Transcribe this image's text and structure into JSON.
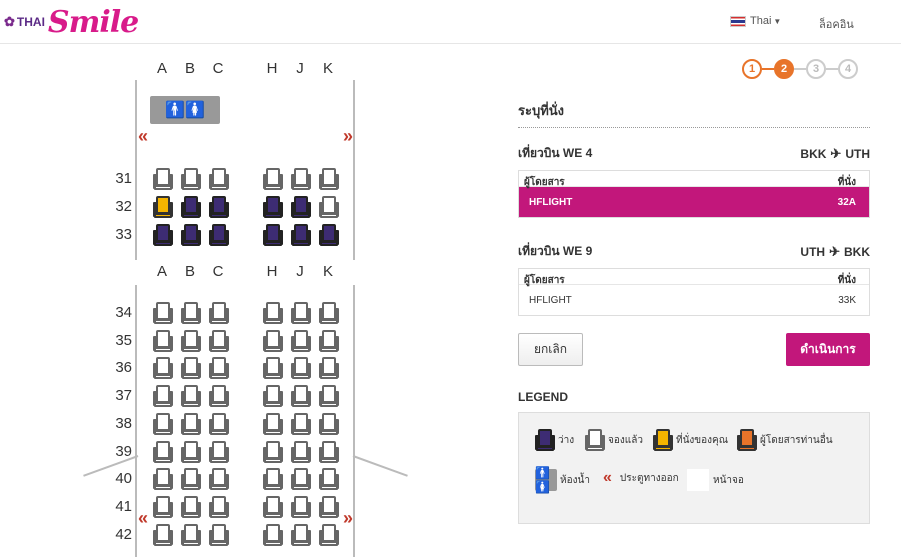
{
  "header": {
    "logo_thai": "THAI",
    "logo_smile": "Smile",
    "language": "Thai",
    "login": "ล็อคอิน"
  },
  "steps": [
    "1",
    "2",
    "3",
    "4"
  ],
  "seatmap": {
    "columns": [
      "A",
      "B",
      "C",
      "H",
      "J",
      "K"
    ],
    "rows_front": [
      {
        "num": "31",
        "seats": [
          "occupied",
          "occupied",
          "occupied",
          "occupied",
          "occupied",
          "occupied"
        ]
      },
      {
        "num": "32",
        "seats": [
          "yours",
          "available",
          "available",
          "available",
          "available",
          "occupied"
        ]
      },
      {
        "num": "33",
        "seats": [
          "available",
          "available",
          "available",
          "available",
          "available",
          "available"
        ]
      }
    ],
    "rows_rear": [
      "34",
      "35",
      "36",
      "37",
      "38",
      "39",
      "40",
      "41",
      "42"
    ]
  },
  "panel": {
    "title": "ระบุที่นั่ง",
    "flights": [
      {
        "label": "เที่ยวบิน WE 4",
        "from": "BKK",
        "to": "UTH",
        "col_passenger": "ผู้โดยสาร",
        "col_seat": "ที่นั่ง",
        "passenger": "HFLIGHT",
        "seat": "32A"
      },
      {
        "label": "เที่ยวบิน WE 9",
        "from": "UTH",
        "to": "BKK",
        "col_passenger": "ผู้โดยสาร",
        "col_seat": "ที่นั่ง",
        "passenger": "HFLIGHT",
        "seat": "33K"
      }
    ],
    "cancel": "ยกเลิก",
    "proceed": "ดำเนินการ"
  },
  "legend": {
    "title": "LEGEND",
    "available": "ว่าง",
    "occupied": "จองแล้ว",
    "yours": "ที่นั่งของคุณ",
    "other": "ผู้โดยสารท่านอื่น",
    "lavatory": "ห้องน้ำ",
    "exit": "ประตูทางออก",
    "screen": "หน้าจอ"
  },
  "icons": {
    "lavatory": "🚹🚺",
    "exit": "«",
    "plane": "✈"
  },
  "colors": {
    "brand": "#c2177b",
    "accent": "#e8742a",
    "available": "#3d2c73",
    "yours": "#f4b400"
  }
}
